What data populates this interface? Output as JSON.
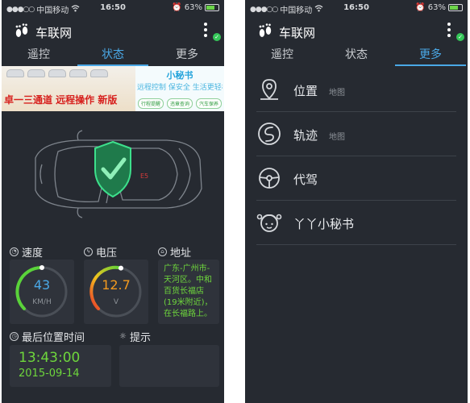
{
  "status_bar": {
    "carrier": "中国移动",
    "time": "16:50",
    "battery": "63%"
  },
  "app": {
    "title": "车联网"
  },
  "tabs": [
    "遥控",
    "状态",
    "更多"
  ],
  "banner": {
    "slogan": "卓一三通道 远程操作 新版",
    "right_title": "小秘书",
    "right_sub": "远程控制 保安全 生活更轻松",
    "tags": [
      "行程提醒",
      "违章查询",
      "汽车保养"
    ]
  },
  "car": {
    "plate_mark": "E5"
  },
  "speed": {
    "label": "速度",
    "value": "43",
    "unit": "KM/H"
  },
  "voltage": {
    "label": "电压",
    "value": "12.7",
    "unit": "V"
  },
  "address": {
    "label": "地址",
    "text": "广东-广州市-天河区。中和百货长福店(19米附近)，在长福路上。"
  },
  "last_position": {
    "label": "最后位置时间",
    "time": "13:43:00",
    "date": "2015-09-14"
  },
  "tip": {
    "label": "提示"
  },
  "more_menu": [
    {
      "label": "位置",
      "sub": "地图",
      "icon": "location-pin-icon"
    },
    {
      "label": "轨迹",
      "sub": "地图",
      "icon": "track-icon"
    },
    {
      "label": "代驾",
      "sub": "",
      "icon": "steering-wheel-icon"
    },
    {
      "label": "丫丫小秘书",
      "sub": "",
      "icon": "assistant-girl-icon"
    }
  ],
  "colors": {
    "accent_blue": "#4aa8e6",
    "green": "#6ed63c",
    "background": "#262a31",
    "card": "#2f333b"
  }
}
